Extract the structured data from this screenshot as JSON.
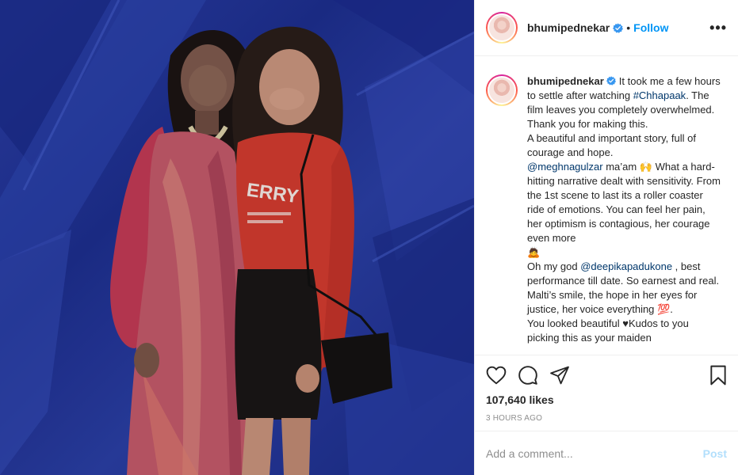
{
  "header": {
    "username": "bhumipednekar",
    "separator": "•",
    "follow_label": "Follow",
    "more_label": "•••"
  },
  "caption": {
    "username": "bhumipednekar",
    "line1": "It took me a few hours to settle after watching ",
    "hashtag": "#Chhapaak",
    "line2": ". The film leaves you completely overwhelmed. Thank you for making this.",
    "para2": "A beautiful and important story, full of courage and hope.",
    "mention1": "@meghnagulzar",
    "para3a": " ma’am ",
    "emoji_raised": "🙌",
    "para3b": " What a hard-hitting narrative dealt with sensitivity. From the 1st scene to last its a roller coaster ride of emotions. You can feel her pain, her optimism is contagious, her courage even more",
    "emoji_person": "🙇",
    "para4a": "Oh my god ",
    "mention2": "@deepikapadukone",
    "para4b": " , best performance till date. So earnest and real. Malti’s smile, the hope in her eyes for justice, her voice everything ",
    "emoji_100": "💯",
    "para4c": ".",
    "para5a": "You looked beautiful ",
    "heart": "♥",
    "para5b": "Kudos to you picking this as your maiden"
  },
  "post": {
    "likes": "107,640 likes",
    "timestamp": "3 HOURS AGO"
  },
  "comment": {
    "placeholder": "Add a comment...",
    "post_label": "Post"
  },
  "colors": {
    "accent": "#0095f6",
    "post_disabled": "#b2dffc",
    "link": "#00376b",
    "muted": "#8e8e8e",
    "photo_background": "#2236a0"
  },
  "icons": [
    "verified-badge-icon",
    "more-options-icon",
    "heart-icon",
    "comment-icon",
    "share-icon",
    "bookmark-icon"
  ]
}
